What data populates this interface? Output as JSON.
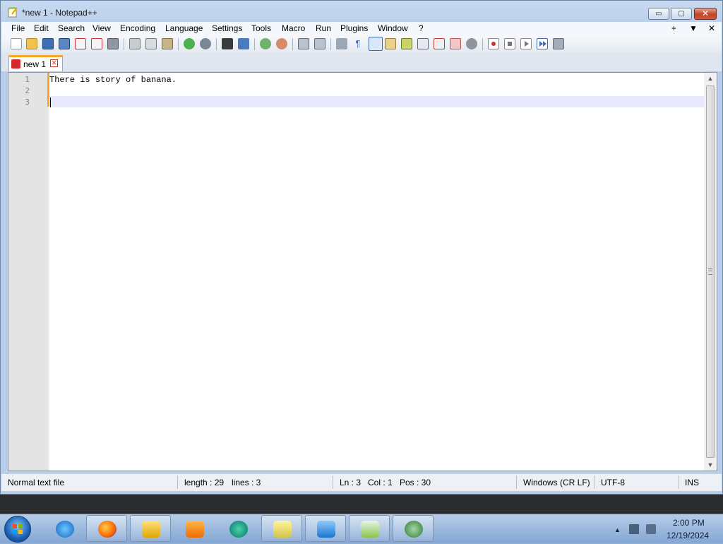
{
  "window": {
    "title": "*new 1 - Notepad++",
    "controls": {
      "minimize": "▭",
      "maximize": "▢",
      "close": "✕"
    }
  },
  "menu": {
    "items": [
      "File",
      "Edit",
      "Search",
      "View",
      "Encoding",
      "Language",
      "Settings",
      "Tools",
      "Macro",
      "Run",
      "Plugins",
      "Window",
      "?"
    ],
    "right": [
      "+",
      "▼",
      "✕"
    ]
  },
  "toolbar": {
    "icons": [
      "new-file-icon",
      "open-file-icon",
      "save-icon",
      "save-all-icon",
      "close-icon",
      "close-all-icon",
      "print-icon",
      "cut-icon",
      "copy-icon",
      "paste-icon",
      "undo-icon",
      "redo-icon",
      "find-icon",
      "replace-icon",
      "zoom-in-icon",
      "zoom-out-icon",
      "sync-vertical-icon",
      "sync-horizontal-icon",
      "word-wrap-icon",
      "show-all-characters-icon",
      "indent-guide-icon",
      "user-defined-language-icon",
      "document-map-icon",
      "function-list-icon",
      "folder-as-workspace-icon",
      "monitoring-icon",
      "record-macro-icon",
      "stop-recording-icon",
      "play-macro-icon",
      "run-macro-multiple-icon",
      "save-macro-icon"
    ]
  },
  "tabs": [
    {
      "label": "new 1",
      "close_glyph": "✕"
    }
  ],
  "editor": {
    "line_numbers": [
      "1",
      "2",
      "3"
    ],
    "lines": [
      "There is story of banana.",
      "",
      ""
    ],
    "current_line": 3
  },
  "statusbar": {
    "file_type": "Normal text file",
    "length": "length : 29",
    "lines": "lines : 3",
    "ln": "Ln : 3",
    "col": "Col : 1",
    "pos": "Pos : 30",
    "eol": "Windows (CR LF)",
    "encoding": "UTF-8",
    "mode": "INS"
  },
  "taskbar": {
    "apps": [
      "internet-explorer-icon",
      "firefox-icon",
      "file-explorer-icon",
      "media-player-icon",
      "app-icon",
      "sticky-notes-icon",
      "control-panel-icon",
      "notepad-plus-plus-icon",
      "app-frog-icon"
    ],
    "time": "2:00 PM",
    "date": "12/19/2024"
  },
  "colors": {
    "accent_tab": "#f5a623",
    "current_line": "#e8e8ff",
    "gutter": "#e4e4e4"
  }
}
